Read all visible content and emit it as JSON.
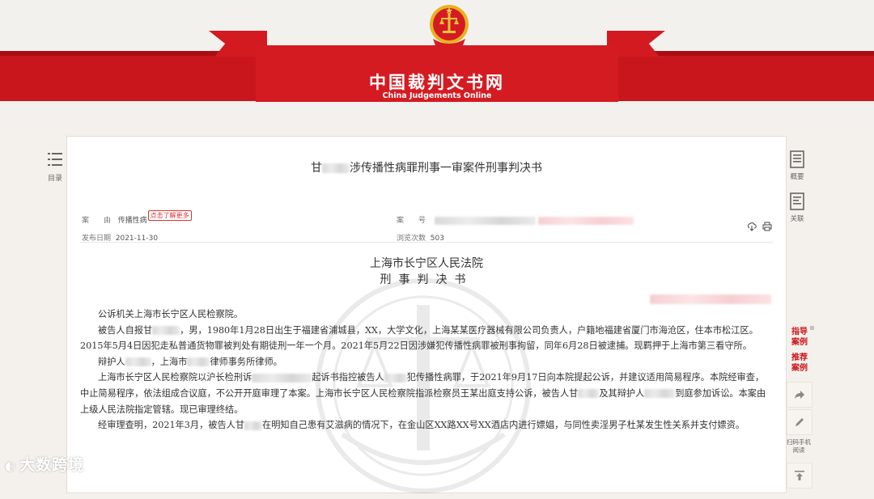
{
  "site": {
    "title": "中国裁判文书网",
    "subtitle": "China Judgements Online",
    "brand_red": "#c9161d"
  },
  "toc": {
    "icon": "list-icon",
    "label": "目录"
  },
  "document": {
    "title_prefix": "甘",
    "title_suffix": "涉传播性病罪刑事一审案件刑事判决书",
    "cause_label": "案　　由",
    "cause_value": "传播性病",
    "cause_more": "点击了解更多",
    "case_no_label": "案　　号",
    "publish_label": "发布日期",
    "publish_date": "2021-11-30",
    "views_label": "浏览次数",
    "views": "503",
    "court": "上海市长宁区人民法院",
    "doc_type": "刑事判决书",
    "paragraphs": {
      "p1": "公诉机关上海市长宁区人民检察院。",
      "p2a": "被告人自报甘",
      "p2b": "，男，1980年1月28日出生于福建省浦城县，XX，大学文化，上海某某医疗器械有限公司负责人，户籍地福建省厦门市海沧区，住本市松江区。2015年5月4日因犯走私普通货物罪被判处有期徒刑一年一个月。2021年5月22日因涉嫌犯传播性病罪被刑事拘留，同年6月28日被逮捕。现羁押于上海市第三看守所。",
      "p3a": "辩护人",
      "p3b": "，上海市",
      "p3c": "律师事务所律师。",
      "p4a": "上海市长宁区人民检察院以沪长检刑诉",
      "p4b": "起诉书指控被告人",
      "p4c": "犯传播性病罪，于2021年9月17日向本院提起公诉，并建议适用简易程序。本院经审查，中止简易程序，依法组成合议庭，不公开开庭审理了本案。上海市长宁区人民检察院指派检察员王某出庭支持公诉，被告人甘",
      "p4d": "及其辩护人",
      "p4e": "到庭参加诉讼。本案由上级人民法院指定管辖。现已审理终结。",
      "p5a": "经审理查明，2021年3月，被告人甘",
      "p5b": "在明知自己患有艾滋病的情况下，在金山区XX路XX号XX酒店内进行嫖娼，与同性卖淫男子杜某发生性关系并支付嫖资。"
    }
  },
  "right_rail": {
    "summary_label": "概要",
    "related_label": "关联",
    "guide_cases": "指导案例",
    "recommend_cases": "推荐案例",
    "qr_label": "扫码手机阅读"
  },
  "watermark_brand": "大数跨境"
}
